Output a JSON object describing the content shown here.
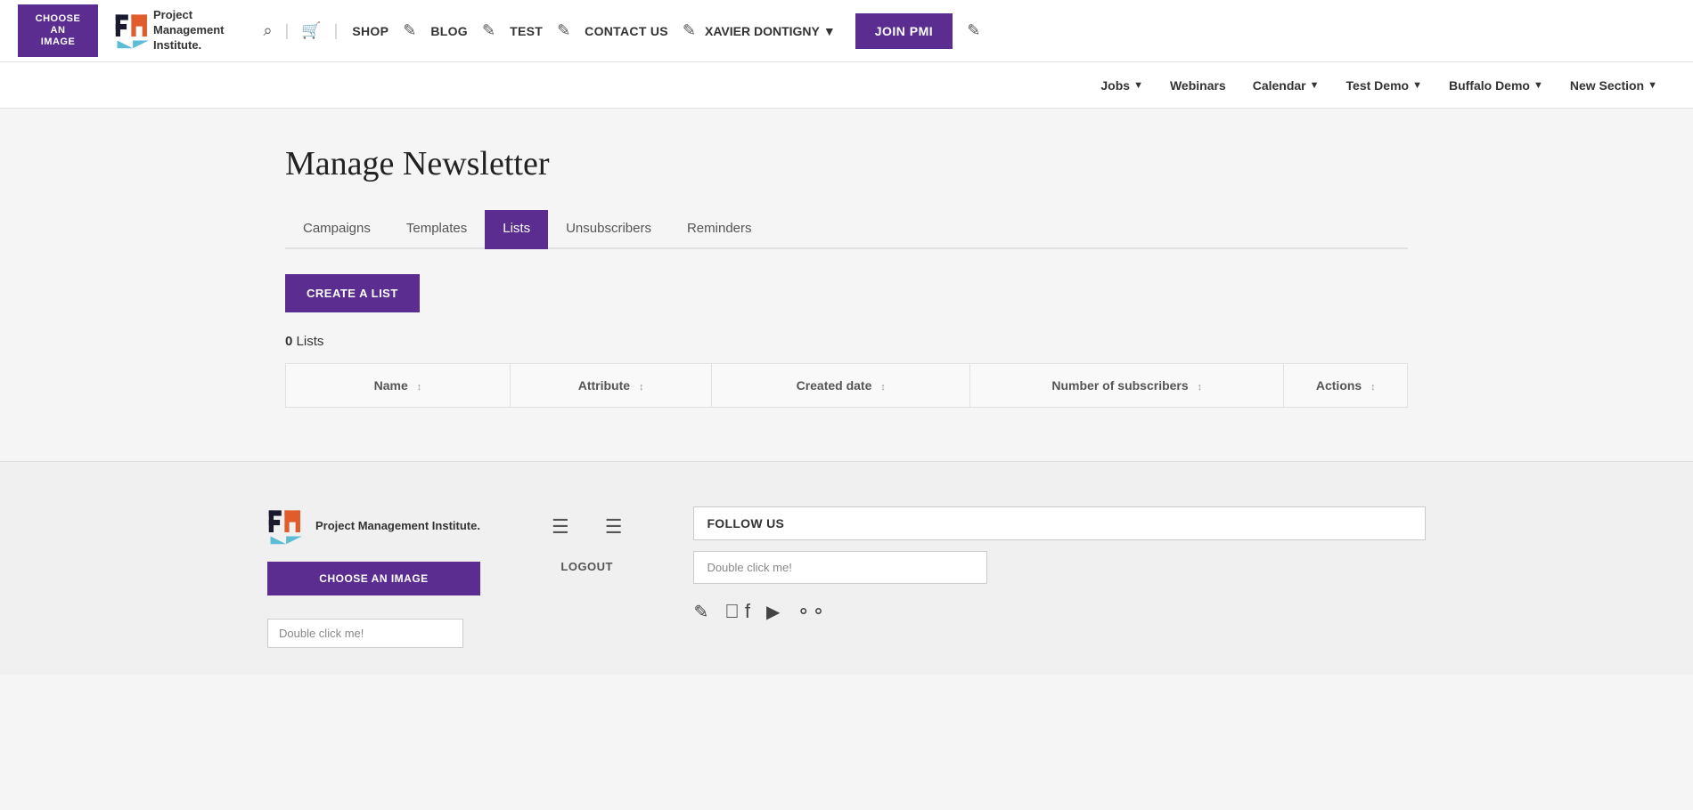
{
  "topnav": {
    "choose_image": "CHOOSE\nAN\nIMAGE",
    "shop": "SHOP",
    "blog": "BLOG",
    "test": "TEST",
    "contact_us": "CONTACT US",
    "user": "XAVIER DONTIGNY",
    "join_pmi": "JOIN PMI"
  },
  "secondarynav": {
    "items": [
      {
        "label": "Jobs",
        "has_arrow": true
      },
      {
        "label": "Webinars",
        "has_arrow": false
      },
      {
        "label": "Calendar",
        "has_arrow": true
      },
      {
        "label": "Test Demo",
        "has_arrow": true
      },
      {
        "label": "Buffalo Demo",
        "has_arrow": true
      },
      {
        "label": "New Section",
        "has_arrow": true
      }
    ]
  },
  "page": {
    "title": "Manage Newsletter"
  },
  "tabs": [
    {
      "label": "Campaigns",
      "active": false
    },
    {
      "label": "Templates",
      "active": false
    },
    {
      "label": "Lists",
      "active": true
    },
    {
      "label": "Unsubscribers",
      "active": false
    },
    {
      "label": "Reminders",
      "active": false
    }
  ],
  "create_list_btn": "CREATE A LIST",
  "lists_count": {
    "prefix": "0",
    "suffix": " Lists"
  },
  "table": {
    "columns": [
      {
        "label": "Name",
        "key": "name"
      },
      {
        "label": "Attribute",
        "key": "attribute"
      },
      {
        "label": "Created date",
        "key": "created_date"
      },
      {
        "label": "Number of subscribers",
        "key": "subscribers"
      },
      {
        "label": "Actions",
        "key": "actions"
      }
    ],
    "rows": []
  },
  "footer": {
    "logo_text_line1": "Project",
    "logo_text_line2": "Management",
    "logo_text_line3": "Institute.",
    "choose_image_btn": "CHOOSE AN IMAGE",
    "double_click_text": "Double click me!",
    "logout_label": "LOGOUT",
    "follow_us": "FOLLOW US",
    "double_click_box": "Double click me!",
    "social_icons": [
      "edit-icon",
      "facebook-icon",
      "youtube-icon",
      "flickr-icon"
    ]
  }
}
